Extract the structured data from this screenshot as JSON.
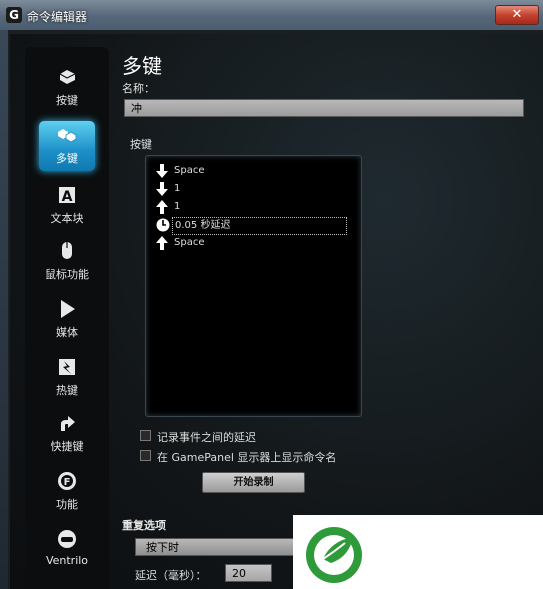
{
  "window": {
    "title": "命令编辑器",
    "close_symbol": "✕",
    "app_logo": "G"
  },
  "sidebar": {
    "items": [
      {
        "label": "按键",
        "icon": "keycap-icon",
        "active": false
      },
      {
        "label": "多键",
        "icon": "multikey-icon",
        "active": true
      },
      {
        "label": "文本块",
        "icon": "text-block-icon",
        "active": false
      },
      {
        "label": "鼠标功能",
        "icon": "mouse-icon",
        "active": false
      },
      {
        "label": "媒体",
        "icon": "play-icon",
        "active": false
      },
      {
        "label": "热键",
        "icon": "hotkey-icon",
        "active": false
      },
      {
        "label": "快捷键",
        "icon": "shortcut-arrow-icon",
        "active": false
      },
      {
        "label": "功能",
        "icon": "function-gear-icon",
        "active": false
      },
      {
        "label": "Ventrilo",
        "icon": "headset-icon",
        "active": false
      }
    ],
    "text_block_glyph": "A",
    "function_glyph": "F"
  },
  "main": {
    "heading": "多键",
    "name_label": "名称：",
    "name_value": "冲",
    "keys_label": "按键",
    "keys": [
      {
        "direction": "down",
        "text": "Space"
      },
      {
        "direction": "down",
        "text": "1"
      },
      {
        "direction": "up",
        "text": "1"
      },
      {
        "direction": "delay",
        "text": "0.05 秒延迟",
        "selected": true
      },
      {
        "direction": "up",
        "text": "Space"
      }
    ],
    "record_delays_label": "记录事件之间的延迟",
    "gamepanel_label": "在 GamePanel 显示器上显示命令名",
    "record_button": "开始录制",
    "repeat_label": "重复选项",
    "repeat_value": "按下时",
    "delay_label": "延迟（毫秒）：",
    "delay_value": "20"
  },
  "colors": {
    "accent": "#1d8fc8",
    "watermark_green": "#2e9a3a"
  },
  "watermark_icon": "leaf-logo-icon"
}
